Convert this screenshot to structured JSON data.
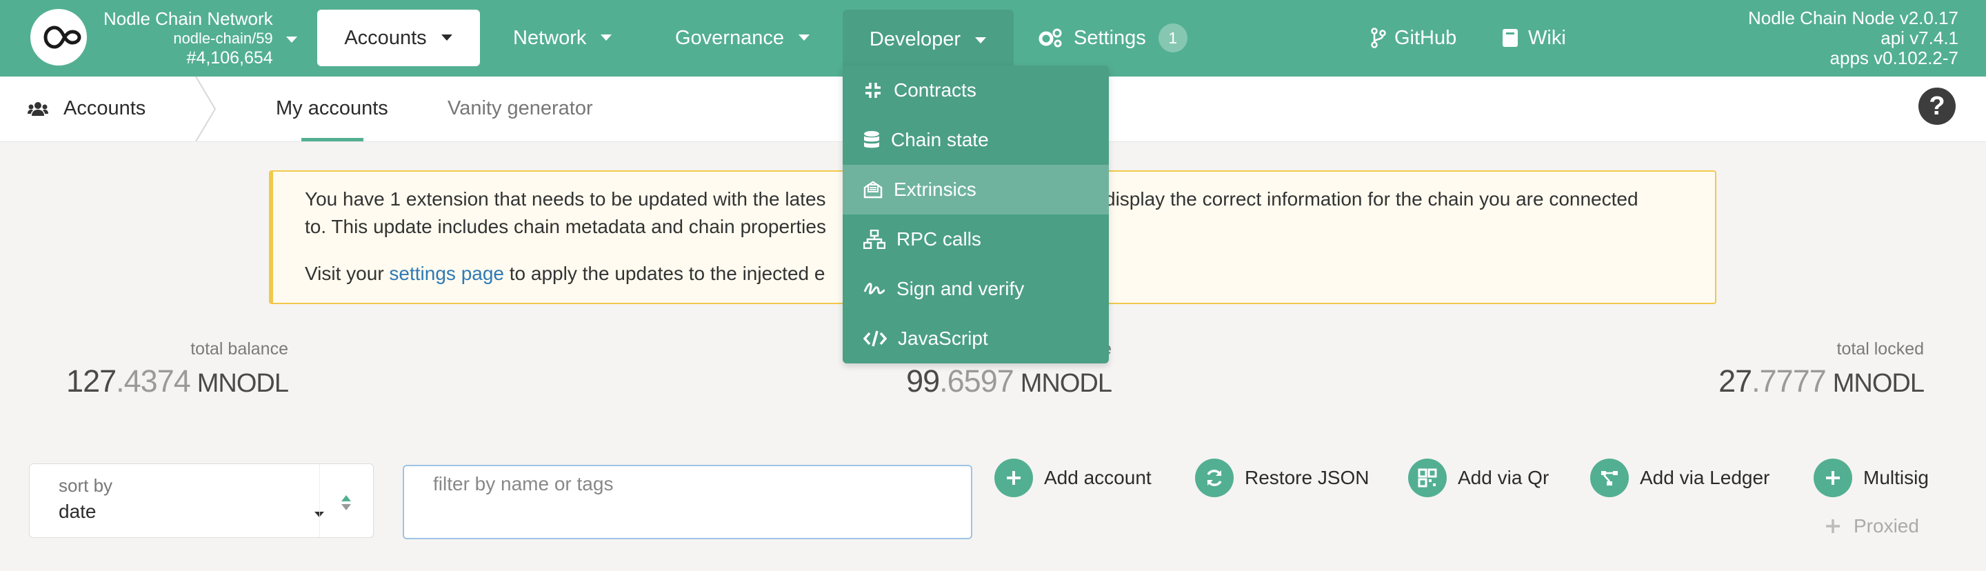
{
  "chain": {
    "name": "Nodle Chain Network",
    "spec": "nodle-chain/59",
    "block": "#4,106,654"
  },
  "nav": {
    "accounts": "Accounts",
    "network": "Network",
    "governance": "Governance",
    "developer": "Developer",
    "settings": "Settings",
    "settings_badge": "1",
    "github": "GitHub",
    "wiki": "Wiki"
  },
  "node": {
    "line1": "Nodle Chain Node v2.0.17",
    "line2": "api v7.4.1",
    "line3": "apps v0.102.2-7"
  },
  "subnav": {
    "section": "Accounts",
    "tab1": "My accounts",
    "tab2": "Vanity generator"
  },
  "warning": {
    "line1a": "You have 1 extension that needs to be updated with the lates",
    "line1b": "display the correct information for the chain you are connected",
    "line2": "to. This update includes chain metadata and chain properties",
    "line3a": "Visit your ",
    "line3link": "settings page",
    "line3b": " to apply the updates to the injected e"
  },
  "summary": {
    "total_balance": {
      "label": "total balance",
      "int": "127",
      "frac": ".4374",
      "unit": "MNODL"
    },
    "transferrable": {
      "label_tail": "e",
      "int": "99",
      "frac": ".6597",
      "unit": "MNODL"
    },
    "total_locked": {
      "label": "total locked",
      "int": "27",
      "frac": ".7777",
      "unit": "MNODL"
    }
  },
  "controls": {
    "sort_label": "sort by",
    "sort_value": "date",
    "filter_placeholder": "filter by name or tags",
    "add_account": "Add account",
    "restore_json": "Restore JSON",
    "add_qr": "Add via Qr",
    "add_ledger": "Add via Ledger",
    "multisig": "Multisig",
    "proxied": "Proxied"
  },
  "developer_menu": {
    "items": [
      "Contracts",
      "Chain state",
      "Extrinsics",
      "RPC calls",
      "Sign and verify",
      "JavaScript"
    ],
    "highlighted": "Extrinsics"
  },
  "colors": {
    "brand": "#53af92",
    "menu": "#4b9f85",
    "menu_highlight": "#6fb39e",
    "warning_border": "#f2c84b",
    "link": "#2e7ab5"
  }
}
